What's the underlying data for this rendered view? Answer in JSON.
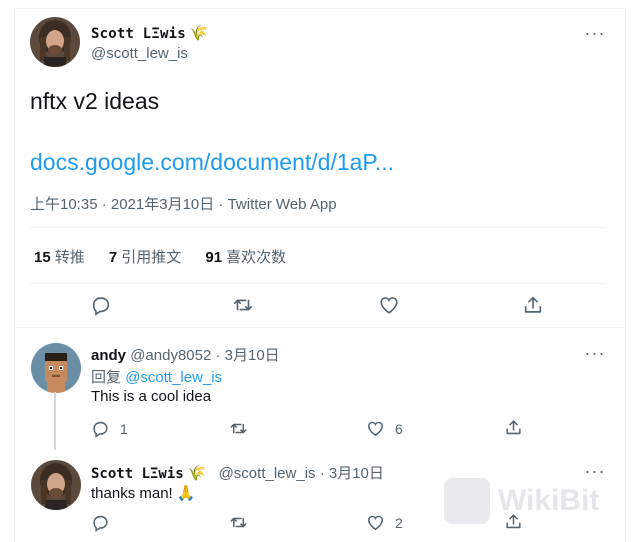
{
  "tweet": {
    "author_name": "Scott LΞwis",
    "author_emoji": "🌾",
    "author_handle": "@scott_lew_is",
    "text": "nftx v2 ideas",
    "link": "docs.google.com/document/d/1aP...",
    "meta": "上午10:35 · 2021年3月10日 · Twitter Web App",
    "stats": [
      {
        "count": "15",
        "label": "转推"
      },
      {
        "count": "7",
        "label": "引用推文"
      },
      {
        "count": "91",
        "label": "喜欢次数"
      }
    ],
    "more": "···"
  },
  "replies": [
    {
      "name": "andy",
      "handle": "@andy8052",
      "sep": "·",
      "date": "3月10日",
      "replying_prefix": "回复",
      "replying_to": "@scott_lew_is",
      "text": "This is a cool idea",
      "reply_count": "1",
      "retweet_count": "",
      "like_count": "6",
      "more": "···"
    },
    {
      "name": "Scott LΞwis",
      "emoji": "🌾",
      "handle": "@scott_lew_is",
      "sep": "·",
      "date": "3月10日",
      "text": "thanks man! 🙏",
      "reply_count": "",
      "retweet_count": "",
      "like_count": "2",
      "more": "···"
    }
  ],
  "watermark": {
    "text": "WikiBit"
  },
  "colors": {
    "link": "#1d9bf0",
    "secondary_text": "#536471",
    "primary_text": "#0f1419",
    "divider": "#eff3f4"
  }
}
